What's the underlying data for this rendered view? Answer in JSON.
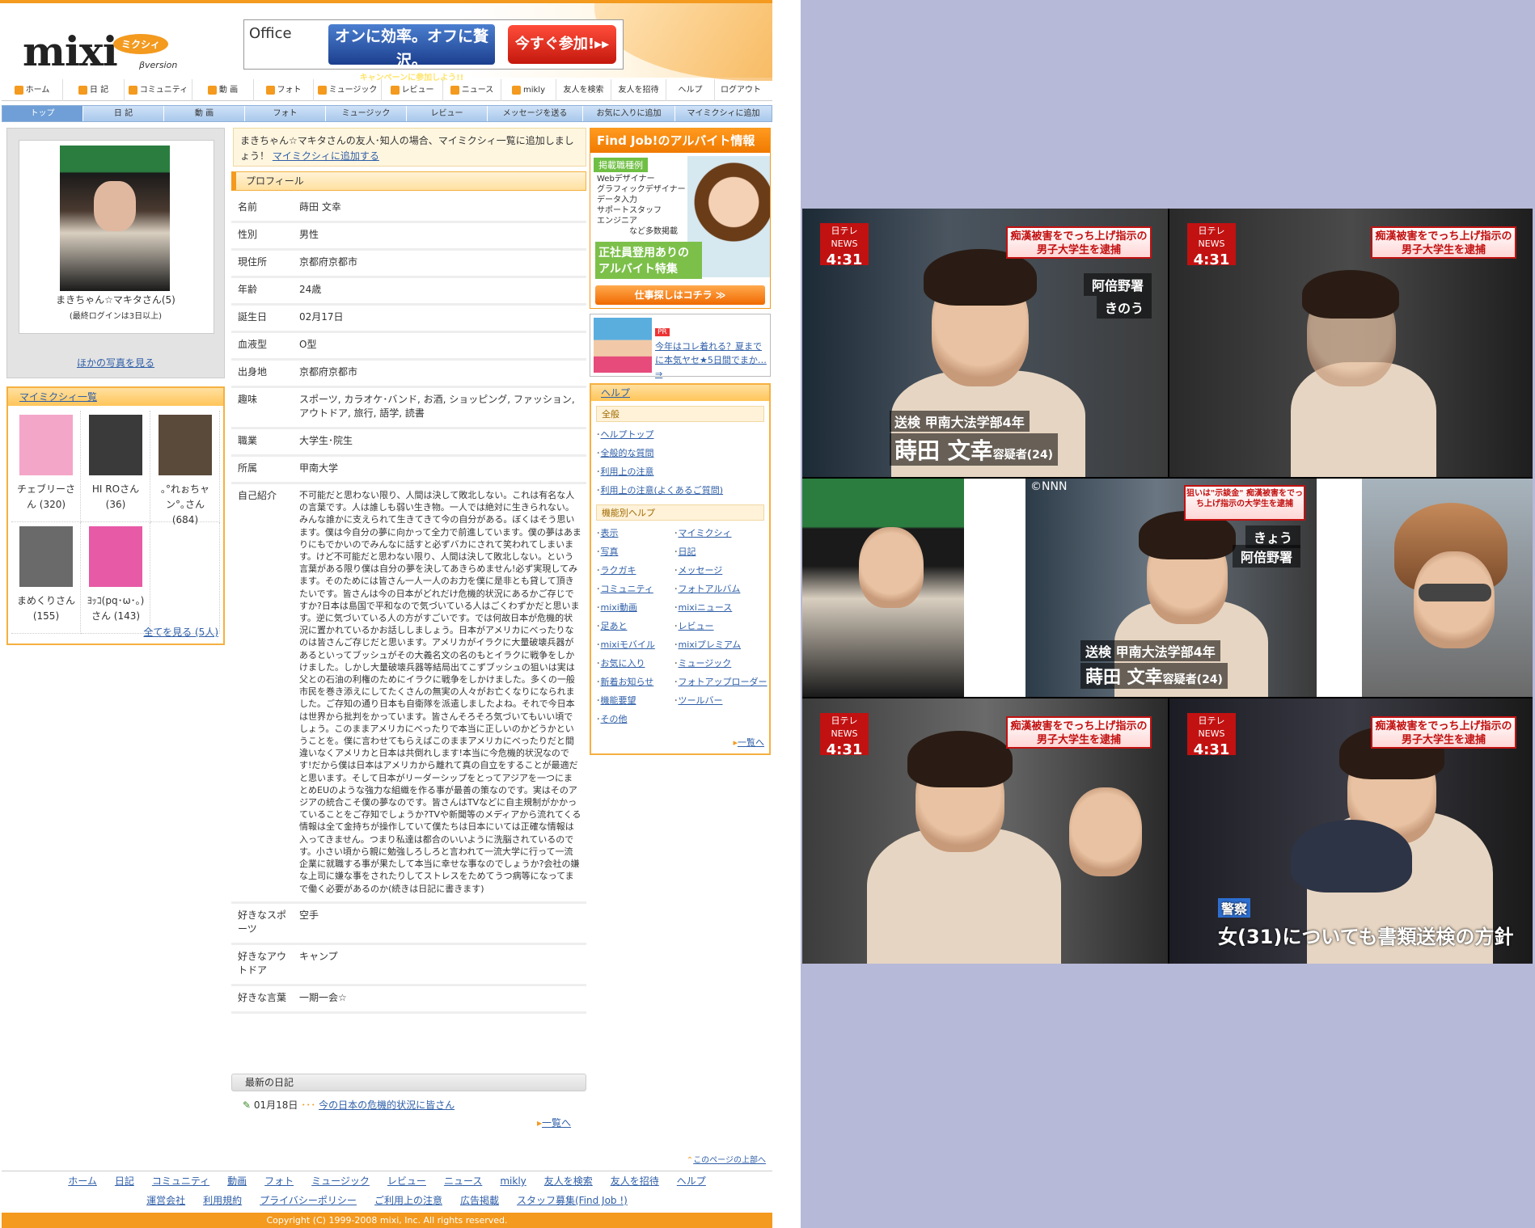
{
  "header": {
    "logo_text": "mixi",
    "logo_badge": "ミクシィ",
    "logo_sub": "βversion",
    "banner": {
      "brand": "Office",
      "headline": "オンに効率。オフに贅沢。",
      "subline": "キャンペーンに参加しよう!!",
      "cta": "今すぐ参加!▸▸"
    }
  },
  "nav_main": [
    "ホーム",
    "日 記",
    "コミュニティ",
    "動 画",
    "フォト",
    "ミュージック",
    "レビュー",
    "ニュース",
    "mikly",
    "友人を検索",
    "友人を招待",
    "ヘルプ",
    "ログアウト"
  ],
  "nav_sub": [
    "トップ",
    "日 記",
    "動 画",
    "フォト",
    "ミュージック",
    "レビュー",
    "メッセージを送る",
    "お気に入りに追加",
    "マイミクシィに追加"
  ],
  "profile_card": {
    "name": "まきちゃん☆マキタさん(5)",
    "last_login": "(最終ログインは3日以上)",
    "more_photos": "ほかの写真を見る"
  },
  "mymixi": {
    "title": "マイミクシィ一覧",
    "friends": [
      {
        "name": "チェブリーさん (320)",
        "thumb": "#f4a6c8"
      },
      {
        "name": "HI ROさん (36)",
        "thumb": "#3a3a3a"
      },
      {
        "name": "｡°れぉちャン°｡さん (684)",
        "thumb": "#5a4a3a"
      },
      {
        "name": "まめくりさん (155)",
        "thumb": "#6a6a6a"
      },
      {
        "name": "ﾖｯｺ(pq･ω･｡)さん (143)",
        "thumb": "#e75aa6"
      }
    ],
    "see_all": "全てを見る (5人)"
  },
  "notice": {
    "text": "まきちゃん☆マキタさんの友人･知人の場合、マイミクシィ一覧に追加しましょう！",
    "link": "マイミクシィに追加する"
  },
  "profile": {
    "heading": "プロフィール",
    "rows": [
      {
        "k": "名前",
        "v": "蒔田 文幸"
      },
      {
        "k": "性別",
        "v": "男性"
      },
      {
        "k": "現住所",
        "v": "京都府京都市"
      },
      {
        "k": "年齢",
        "v": "24歳"
      },
      {
        "k": "誕生日",
        "v": "02月17日"
      },
      {
        "k": "血液型",
        "v": "O型"
      },
      {
        "k": "出身地",
        "v": "京都府京都市"
      },
      {
        "k": "趣味",
        "v": "スポーツ, カラオケ･バンド, お酒, ショッピング, ファッション, アウトドア, 旅行, 語学, 読書"
      },
      {
        "k": "職業",
        "v": "大学生･院生"
      },
      {
        "k": "所属",
        "v": "甲南大学"
      },
      {
        "k": "自己紹介",
        "v": "不可能だと思わない限り、人間は決して敗北しない。これは有名な人の言葉です。人は誰しも弱い生き物。一人では絶対に生きられない。みんな誰かに支えられて生きてきて今の自分がある。ぼくはそう思います。僕は今自分の夢に向かって全力で前進しています。僕の夢はあまりにもでかいのでみんなに話すと必ずバカにされて笑われてしまいます。けど不可能だと思わない限り、人間は決して敗北しない。という言葉がある限り僕は自分の夢を決してあきらめません!必ず実現してみます。そのためには皆さん一人一人のお力を僕に是非とも貸して頂きたいです。皆さんは今の日本がどれだけ危機的状況にあるかご存じですか?日本は島国で平和なので気づいている人はごくわずかだと思います。逆に気づいている人の方がすごいです。では何故日本が危機的状況に置かれているかお話ししましょう。日本がアメリカにべったりなのは皆さんご存じだと思います。アメリカがイラクに大量破壊兵器があるといってブッシュがその大義名文の名のもとイラクに戦争をしかけました。しかし大量破壊兵器等結局出てこずブッシュの狙いは実は父との石油の利権のためにイラクに戦争をしかけました。多くの一般市民を巻き添えにしてたくさんの無実の人々がお亡くなりになられました。ご存知の通り日本も自衛隊を派遣しましたよね。それで今日本は世界から批判をかっています。皆さんそろそろ気づいてもいい頃でしょう。このままアメリカにべったりで本当に正しいのかどうかということを。僕に言わせてもらえばこのままアメリカにべったりだと間違いなくアメリカと日本は共倒れします!本当に今危機的状況なのです!だから僕は日本はアメリカから離れて真の自立をすることが最適だと思います。そして日本がリーダーシップをとってアジアを一つにまとめEUのような強力な組織を作る事が最善の策なのです。実はそのアジアの統合こそ僕の夢なのです。皆さんはTVなどに自主規制がかかっていることをご存知でしょうか?TVや新聞等のメディアから流れてくる情報は全て金持ちが操作していて僕たちは日本にいては正確な情報は入ってきません。つまり私達は都合のいいように洗脳されているのです。小さい頃から親に勉強しろしろと言われて一流大学に行って一流企業に就職する事が果たして本当に幸せな事なのでしょうか?会社の嫌な上司に嫌な事をされたりしてストレスをためてうつ病等になってまで働く必要があるのか(続きは日記に書きます)"
      },
      {
        "k": "好きなスポーツ",
        "v": "空手"
      },
      {
        "k": "好きなアウトドア",
        "v": "キャンプ"
      },
      {
        "k": "好きな言葉",
        "v": "一期一会☆"
      }
    ]
  },
  "diary": {
    "heading": "最新の日記",
    "date": "01月18日",
    "title": "今の日本の危機的状況に皆さん",
    "more": "一覧へ"
  },
  "findjob": {
    "title": "Find Job!のアルバイト情報",
    "tag": "掲載職種例",
    "jobs": [
      "Webデザイナー",
      "グラフィックデザイナー",
      "データ入力",
      "サポートスタッフ",
      "エンジニア"
    ],
    "etc": "など多数掲載",
    "promo": "正社員登用ありのアルバイト特集",
    "button": "仕事探しはコチラ ≫"
  },
  "ad": {
    "label": "PR",
    "text": "今年はコレ着れる？夏までに本気ヤセ★5日間でまか…⇒"
  },
  "help": {
    "title": "ヘルプ",
    "general_heading": "全般",
    "general": [
      "ヘルプトップ",
      "全般的な質問",
      "利用上の注意",
      "利用上の注意(よくあるご質問)"
    ],
    "feature_heading": "機能別ヘルプ",
    "features": [
      "表示",
      "マイミクシィ",
      "写真",
      "日記",
      "ラクガキ",
      "メッセージ",
      "コミュニティ",
      "フォトアルバム",
      "mixi動画",
      "mixiニュース",
      "足あと",
      "レビュー",
      "mixiモバイル",
      "mixiプレミアム",
      "お気に入り",
      "ミュージック",
      "新着お知らせ",
      "フォトアップローダー",
      "機能要望",
      "ツールバー",
      "その他"
    ],
    "more": "一覧へ"
  },
  "footer": {
    "to_top": "このページの上部へ",
    "row1": [
      "ホーム",
      "日記",
      "コミュニティ",
      "動画",
      "フォト",
      "ミュージック",
      "レビュー",
      "ニュース",
      "mikly",
      "友人を検索",
      "友人を招待",
      "ヘルプ"
    ],
    "row2": [
      "運営会社",
      "利用規約",
      "プライバシーポリシー",
      "ご利用上の注意",
      "広告掲載",
      "スタッフ募集(Find Job !)"
    ],
    "copyright": "Copyright (C) 1999-2008 mixi, Inc. All rights reserved."
  },
  "news": {
    "station_logo": "日テレ NEWS",
    "time": "4:31",
    "headline": "痴漢被害をでっち上げ指示の男子大学生を逮捕",
    "headline2": "狙いは\"示談金\" 痴漢被害をでっち上げ指示の大学生を逮捕",
    "loc1": "阿倍野署",
    "when1": "きのう",
    "loc2": "阿倍野署",
    "when2": "きょう",
    "caption_line1": "送検 甲南大法学部4年",
    "caption_name": "蒔田 文幸",
    "caption_suffix": "容疑者(24)",
    "credit": "©NNN",
    "police_tag": "警察",
    "bottom_caption": "女(31)についても書類送検の方針"
  }
}
